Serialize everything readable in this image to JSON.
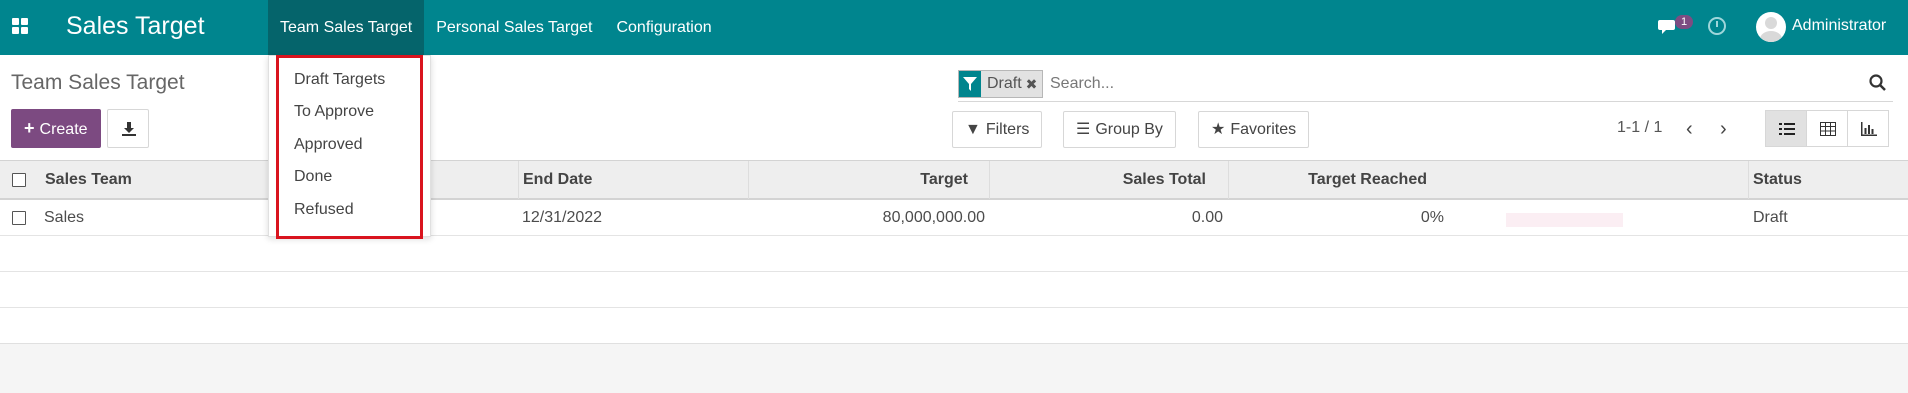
{
  "navbar": {
    "brand": "Sales Target",
    "menu": [
      "Team Sales Target",
      "Personal Sales Target",
      "Configuration"
    ],
    "chat_badge": "1",
    "user": "Administrator",
    "color": "#00858e"
  },
  "dropdown": {
    "items": [
      "Draft Targets",
      "To Approve",
      "Approved",
      "Done",
      "Refused"
    ]
  },
  "control": {
    "breadcrumb": "Team Sales Target",
    "create_label": "Create",
    "search_placeholder": "Search...",
    "facet_label": "Draft",
    "filters_label": "Filters",
    "groupby_label": "Group By",
    "favorites_label": "Favorites",
    "pager": "1-1 / 1"
  },
  "table": {
    "headers": {
      "team": "Sales Team",
      "end_date": "End Date",
      "target": "Target",
      "sales_total": "Sales Total",
      "target_reached": "Target Reached",
      "status": "Status"
    },
    "rows": [
      {
        "team": "Sales",
        "end_date": "12/31/2022",
        "target": "80,000,000.00",
        "sales_total": "0.00",
        "target_reached": "0%",
        "target_reached_value": 0,
        "status": "Draft"
      }
    ]
  },
  "colors": {
    "primary": "#7c4a81",
    "highlight": "#d9141e"
  }
}
